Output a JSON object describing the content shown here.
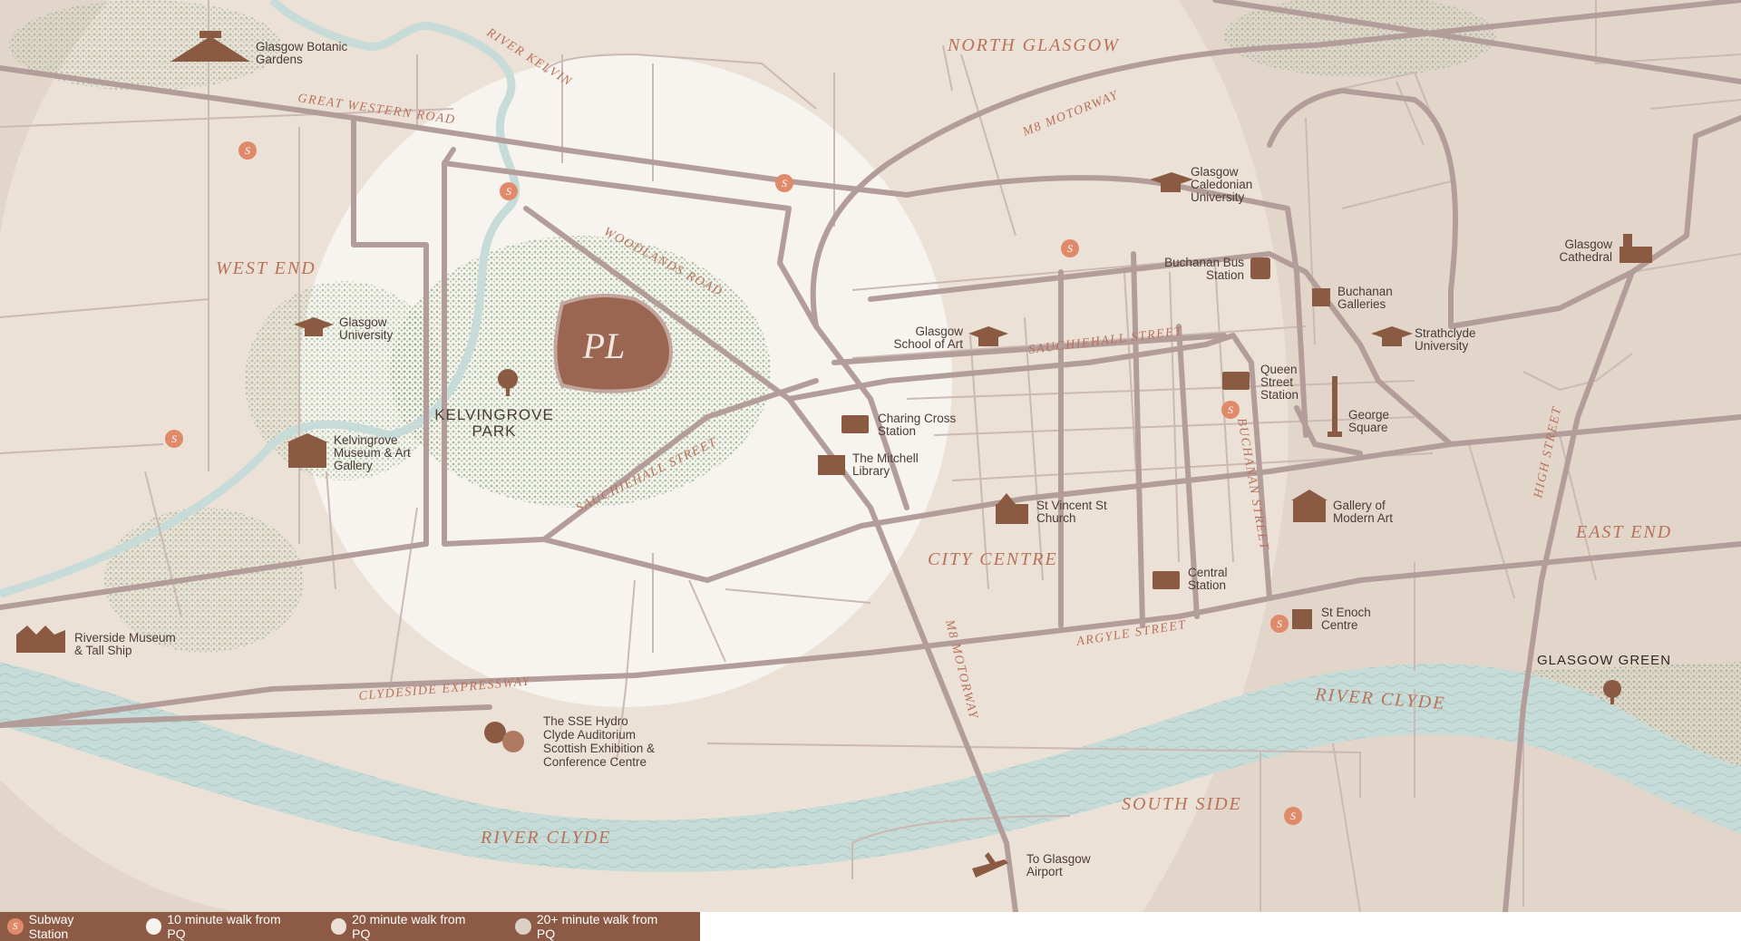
{
  "colors": {
    "background": "#ece1d6",
    "outer_zone": "#e2d5ca",
    "mid_zone": "#efe7de",
    "inner_zone": "#f7f3ee",
    "road": "#b39d9b",
    "river": "#c7dcd8",
    "park": "#8fb08a",
    "label": "#b8725a",
    "icon": "#8a5a42",
    "subway": "#e08a6c",
    "legend_bg": "#8d5a45"
  },
  "areas": {
    "north_glasgow": "NORTH GLASGOW",
    "west_end": "WEST END",
    "city_centre": "CITY CENTRE",
    "east_end": "EAST END",
    "south_side": "SOUTH SIDE",
    "glasgow_green": "GLASGOW GREEN"
  },
  "rivers": {
    "kelvin": "RIVER KELVIN",
    "clyde_west": "RIVER CLYDE",
    "clyde_east": "RIVER CLYDE"
  },
  "roads": {
    "great_western": "GREAT WESTERN ROAD",
    "m8_north": "M8 MOTORWAY",
    "woodlands": "WOODLANDS ROAD",
    "sauchiehall_west": "SAUCHIEHALL STREET",
    "sauchiehall_east": "SAUCHIEHALL STREET",
    "buchanan": "BUCHANAN STREET",
    "high_street": "HIGH STREET",
    "argyle": "ARGYLE STREET",
    "clydeside": "CLYDESIDE EXPRESSWAY",
    "m8_south": "M8 MOTORWAY"
  },
  "park": {
    "line1": "KELVINGROVE",
    "line2": "PARK"
  },
  "places": {
    "botanic": [
      "Glasgow Botanic",
      "Gardens"
    ],
    "glasgow_uni": [
      "Glasgow",
      "University"
    ],
    "kelvingrove_museum": [
      "Kelvingrove",
      "Museum & Art",
      "Gallery"
    ],
    "riverside": [
      "Riverside Museum",
      "& Tall Ship"
    ],
    "sse": [
      "The SSE Hydro",
      "Clyde Auditorium",
      "Scottish Exhibition &",
      "Conference Centre"
    ],
    "airport": [
      "To Glasgow",
      "Airport"
    ],
    "gcu": [
      "Glasgow",
      "Caledonian",
      "University"
    ],
    "bus": [
      "Buchanan Bus",
      "Station"
    ],
    "cathedral": [
      "Glasgow",
      "Cathedral"
    ],
    "buchanan_galleries": [
      "Buchanan",
      "Galleries"
    ],
    "strathclyde": [
      "Strathclyde",
      "University"
    ],
    "school_of_art": [
      "Glasgow",
      "School of Art"
    ],
    "queen_street": [
      "Queen",
      "Street",
      "Station"
    ],
    "george_square": [
      "George",
      "Square"
    ],
    "charing_cross": [
      "Charing Cross",
      "Station"
    ],
    "mitchell": [
      "The Mitchell",
      "Library"
    ],
    "st_vincent": [
      "St Vincent St",
      "Church"
    ],
    "goma": [
      "Gallery of",
      "Modern Art"
    ],
    "central": [
      "Central",
      "Station"
    ],
    "st_enoch": [
      "St Enoch",
      "Centre"
    ]
  },
  "subway_glyph": "S",
  "legend": {
    "subway": "Subway Station",
    "ten_min": "10 minute walk from PQ",
    "twenty_min": "20 minute walk from PQ",
    "twenty_plus": "20+ minute walk from PQ"
  }
}
